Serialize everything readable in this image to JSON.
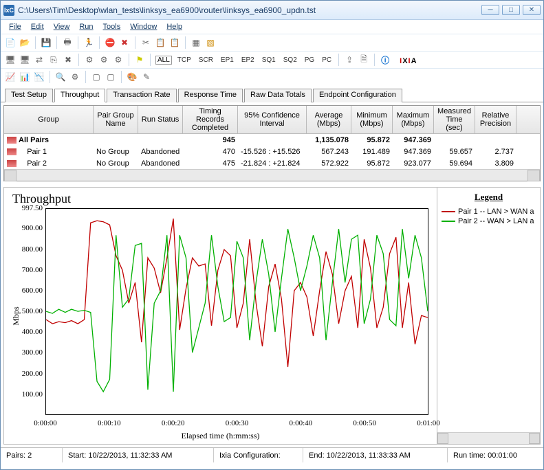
{
  "window": {
    "app_icon": "IxC",
    "path": "C:\\Users\\Tim\\Desktop\\wlan_tests\\linksys_ea6900\\router\\linksys_ea6900_updn.tst",
    "btn_min": "─",
    "btn_max": "□",
    "btn_close": "✕"
  },
  "menu": {
    "file": "File",
    "edit": "Edit",
    "view": "View",
    "run": "Run",
    "tools": "Tools",
    "window": "Window",
    "help": "Help"
  },
  "toolbar2": {
    "all": "ALL",
    "tcp": "TCP",
    "scr": "SCR",
    "ep1": "EP1",
    "ep2": "EP2",
    "sq1": "SQ1",
    "sq2": "SQ2",
    "pg": "PG",
    "pc": "PC"
  },
  "brand": {
    "full": "IXIA"
  },
  "tabs": [
    "Test Setup",
    "Throughput",
    "Transaction Rate",
    "Response Time",
    "Raw Data Totals",
    "Endpoint Configuration"
  ],
  "active_tab": 1,
  "grid": {
    "cols": [
      "Group",
      "Pair Group Name",
      "Run Status",
      "Timing Records Completed",
      "95% Confidence Interval",
      "Average (Mbps)",
      "Minimum (Mbps)",
      "Maximum (Mbps)",
      "Measured Time (sec)",
      "Relative Precision"
    ],
    "rows": [
      {
        "icon": true,
        "group": "All Pairs",
        "pgname": "",
        "status": "",
        "trc": "945",
        "ci": "",
        "avg": "1,135.078",
        "min": "95.872",
        "max": "947.369",
        "mt": "",
        "rp": "",
        "bold": true
      },
      {
        "icon": true,
        "group": "Pair 1",
        "pgname": "No Group",
        "status": "Abandoned",
        "trc": "470",
        "ci": "-15.526 : +15.526",
        "avg": "567.243",
        "min": "191.489",
        "max": "947.369",
        "mt": "59.657",
        "rp": "2.737"
      },
      {
        "icon": true,
        "group": "Pair 2",
        "pgname": "No Group",
        "status": "Abandoned",
        "trc": "475",
        "ci": "-21.824 : +21.824",
        "avg": "572.922",
        "min": "95.872",
        "max": "923.077",
        "mt": "59.694",
        "rp": "3.809"
      }
    ]
  },
  "chart": {
    "title": "Throughput",
    "ylabel": "Mbps",
    "xlabel": "Elapsed time (h:mm:ss)",
    "legend_title": "Legend",
    "legend": [
      {
        "color": "#c00000",
        "label": "Pair 1 -- LAN > WAN a"
      },
      {
        "color": "#00b000",
        "label": "Pair 2 -- WAN > LAN a"
      }
    ],
    "yticks": [
      "997.50",
      "900.00",
      "800.00",
      "700.00",
      "600.00",
      "500.00",
      "400.00",
      "300.00",
      "200.00",
      "100.00"
    ],
    "xticks": [
      "0:00:00",
      "0:00:10",
      "0:00:20",
      "0:00:30",
      "0:00:40",
      "0:00:50",
      "0:01:00"
    ]
  },
  "status": {
    "pairs": "Pairs: 2",
    "start": "Start: 10/22/2013, 11:32:33 AM",
    "ixia": "Ixia Configuration:",
    "end": "End: 10/22/2013, 11:33:33 AM",
    "runtime": "Run time: 00:01:00"
  },
  "chart_data": {
    "type": "line",
    "xlabel": "Elapsed time (h:mm:ss)",
    "ylabel": "Mbps",
    "xrange_seconds": [
      0,
      60
    ],
    "ylim": [
      0,
      997.5
    ],
    "series": [
      {
        "name": "Pair 1 -- LAN > WAN",
        "color": "#c00000",
        "x": [
          0,
          1,
          2,
          3,
          4,
          5,
          6,
          7,
          8,
          9,
          10,
          11,
          12,
          13,
          14,
          15,
          16,
          17,
          18,
          19,
          20,
          21,
          22,
          23,
          24,
          25,
          26,
          27,
          28,
          29,
          30,
          31,
          32,
          33,
          34,
          35,
          36,
          37,
          38,
          39,
          40,
          41,
          42,
          43,
          44,
          45,
          46,
          47,
          48,
          49,
          50,
          51,
          52,
          53,
          54,
          55,
          56,
          57,
          58,
          59,
          60
        ],
        "y": [
          460,
          440,
          450,
          445,
          455,
          440,
          460,
          930,
          940,
          935,
          920,
          770,
          700,
          540,
          640,
          350,
          760,
          710,
          590,
          760,
          950,
          410,
          610,
          760,
          720,
          730,
          430,
          700,
          800,
          770,
          420,
          540,
          850,
          540,
          330,
          620,
          730,
          560,
          230,
          600,
          640,
          570,
          380,
          600,
          790,
          680,
          440,
          600,
          670,
          420,
          850,
          710,
          420,
          520,
          780,
          860,
          420,
          640,
          340,
          480,
          470
        ]
      },
      {
        "name": "Pair 2 -- WAN > LAN",
        "color": "#00b000",
        "x": [
          0,
          1,
          2,
          3,
          4,
          5,
          6,
          7,
          8,
          9,
          10,
          11,
          12,
          13,
          14,
          15,
          16,
          17,
          18,
          19,
          20,
          21,
          22,
          23,
          24,
          25,
          26,
          27,
          28,
          29,
          30,
          31,
          32,
          33,
          34,
          35,
          36,
          37,
          38,
          39,
          40,
          41,
          42,
          43,
          44,
          45,
          46,
          47,
          48,
          49,
          50,
          51,
          52,
          53,
          54,
          55,
          56,
          57,
          58,
          59,
          60
        ],
        "y": [
          500,
          490,
          510,
          495,
          510,
          500,
          505,
          495,
          160,
          110,
          170,
          870,
          520,
          560,
          820,
          830,
          120,
          540,
          600,
          870,
          110,
          870,
          760,
          300,
          420,
          540,
          870,
          620,
          450,
          470,
          840,
          760,
          360,
          640,
          850,
          680,
          400,
          660,
          900,
          760,
          600,
          720,
          870,
          760,
          360,
          640,
          900,
          640,
          850,
          870,
          440,
          560,
          870,
          780,
          460,
          430,
          900,
          660,
          870,
          760,
          500
        ]
      }
    ]
  }
}
